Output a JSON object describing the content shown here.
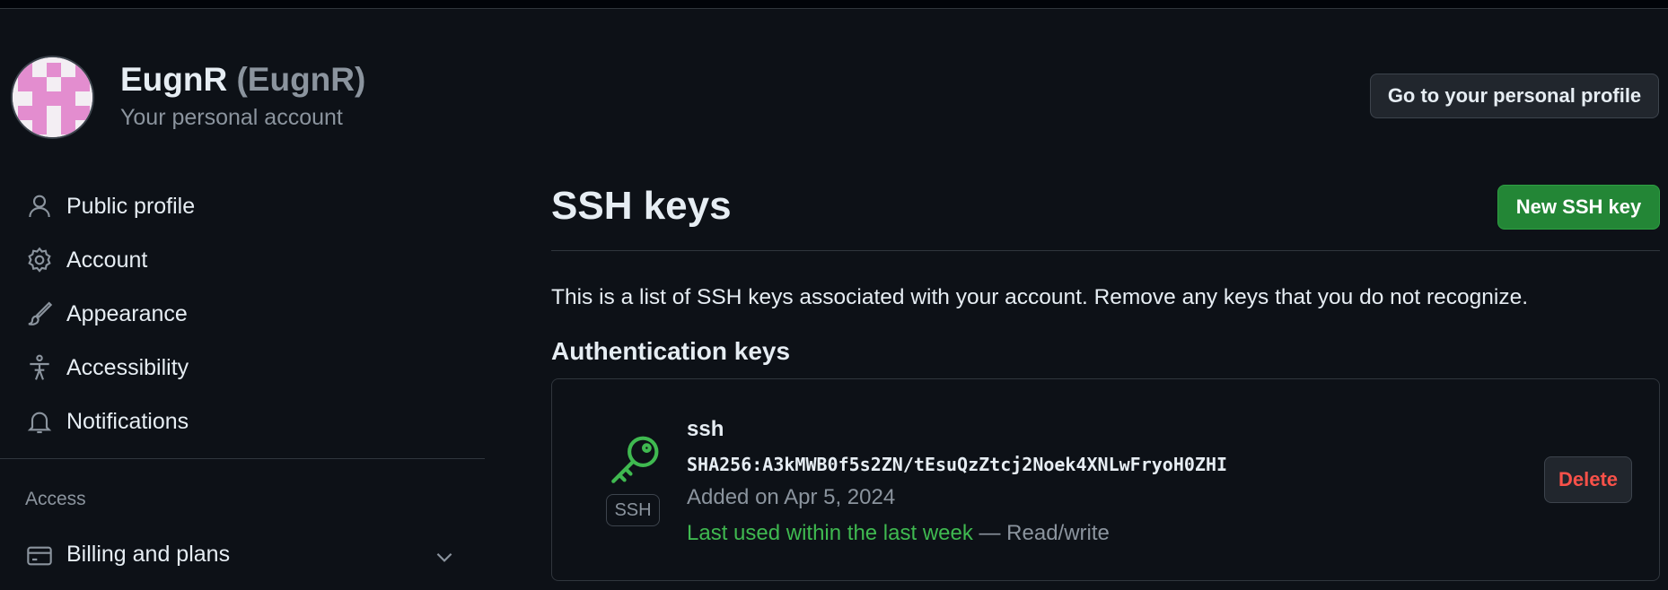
{
  "account": {
    "name": "EugnR",
    "handle": "(EugnR)",
    "subtitle": "Your personal account",
    "go_profile_label": "Go to your personal profile"
  },
  "sidebar": {
    "items": [
      {
        "label": "Public profile",
        "icon": "person-icon"
      },
      {
        "label": "Account",
        "icon": "gear-icon"
      },
      {
        "label": "Appearance",
        "icon": "paintbrush-icon"
      },
      {
        "label": "Accessibility",
        "icon": "accessibility-icon"
      },
      {
        "label": "Notifications",
        "icon": "bell-icon"
      }
    ],
    "section_heading": "Access",
    "billing": {
      "label": "Billing and plans",
      "icon": "credit-card-icon",
      "chevron": "chevron-down-icon"
    }
  },
  "main": {
    "title": "SSH keys",
    "new_key_label": "New SSH key",
    "description": "This is a list of SSH keys associated with your account. Remove any keys that you do not recognize.",
    "section_title": "Authentication keys",
    "keys": [
      {
        "name": "ssh",
        "badge": "SSH",
        "fingerprint": "SHA256:A3kMWB0f5s2ZN/tEsuQzZtcj2Noek4XNLwFryoH0ZHI",
        "added": "Added on Apr 5, 2024",
        "last_used": "Last used within the last week",
        "access": "— Read/write",
        "delete_label": "Delete"
      }
    ]
  },
  "colors": {
    "background": "#0d1117",
    "border": "#30363d",
    "text": "#e6edf3",
    "muted": "#8b949e",
    "primary_button": "#238636",
    "success_text": "#3fb950",
    "danger_text": "#f85149",
    "avatar_pink": "#e38dcf"
  }
}
